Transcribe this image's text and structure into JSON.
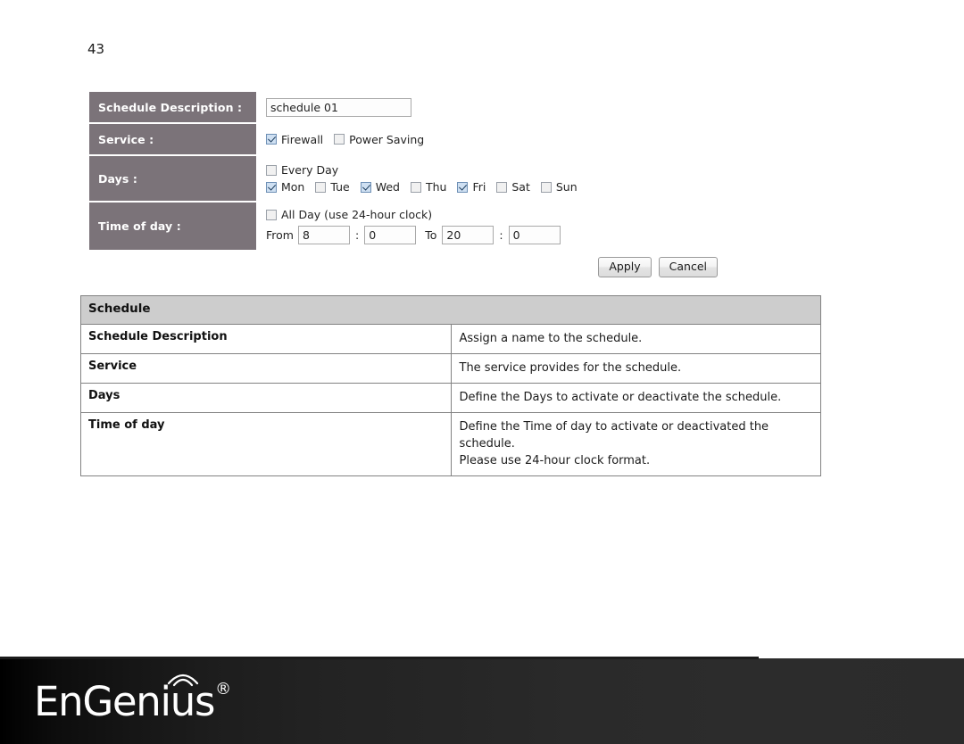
{
  "page": {
    "number": "43"
  },
  "form": {
    "rows": [
      {
        "label": "Schedule Description :"
      },
      {
        "label": "Service :"
      },
      {
        "label": "Days :"
      },
      {
        "label": "Time of day :"
      }
    ],
    "schedule_description": {
      "value": "schedule 01",
      "placeholder": ""
    },
    "service": {
      "options": [
        {
          "label": "Firewall",
          "checked": true
        },
        {
          "label": "Power Saving",
          "checked": false
        }
      ]
    },
    "days": {
      "every_day": {
        "label": "Every Day",
        "checked": false
      },
      "options": [
        {
          "label": "Mon",
          "checked": true
        },
        {
          "label": "Tue",
          "checked": false
        },
        {
          "label": "Wed",
          "checked": true
        },
        {
          "label": "Thu",
          "checked": false
        },
        {
          "label": "Fri",
          "checked": true
        },
        {
          "label": "Sat",
          "checked": false
        },
        {
          "label": "Sun",
          "checked": false
        }
      ]
    },
    "time_of_day": {
      "all_day": {
        "label": "All Day (use 24-hour clock)",
        "checked": false
      },
      "from_label": "From",
      "to_label": "To",
      "separator": ":",
      "from_hour": "8",
      "from_minute": "0",
      "to_hour": "20",
      "to_minute": "0"
    },
    "buttons": {
      "apply": "Apply",
      "cancel": "Cancel"
    }
  },
  "help_table": {
    "header": "Schedule",
    "rows": [
      {
        "key": "Schedule Description",
        "value": "Assign a name to the schedule."
      },
      {
        "key": "Service",
        "value": "The service provides for the schedule."
      },
      {
        "key": "Days",
        "value": "Define the Days to activate or deactivate the schedule."
      },
      {
        "key": "Time of day",
        "value": "Define the Time of day to activate or deactivated the schedule.",
        "value2": "Please use 24-hour clock format."
      }
    ]
  },
  "footer": {
    "brand_part1": "EnGenius",
    "brand_mark": "®"
  },
  "colors": {
    "label_panel": "#7b7379",
    "table_header": "#cdcdcd",
    "footer_dark": "#2b2b2b",
    "checkbox_checked": "#cfe0f2"
  }
}
